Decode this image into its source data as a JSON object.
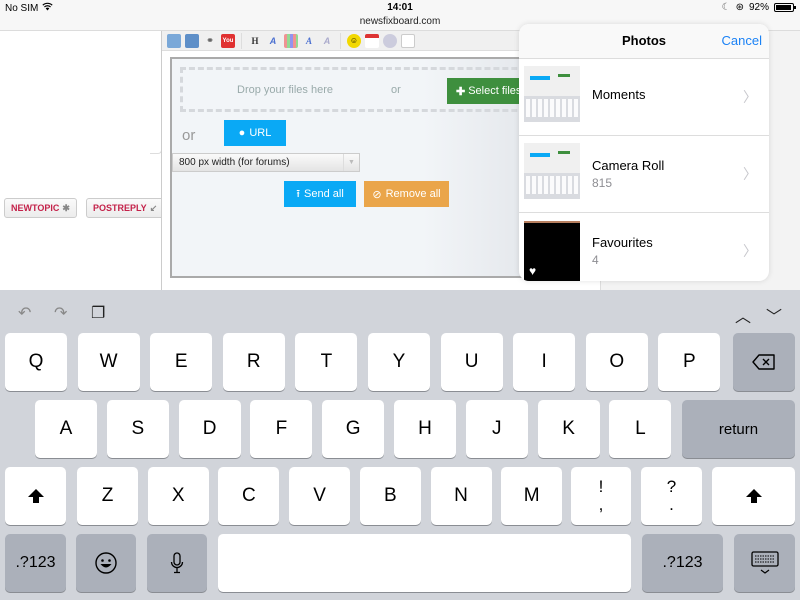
{
  "status_bar": {
    "carrier": "No SIM",
    "time": "14:01",
    "url": "newsfixboard.com",
    "battery_percent": "92%",
    "battery_level": 0.92
  },
  "forum": {
    "new_topic": "NEWTOPIC",
    "post_reply": "POSTREPLY",
    "toolbar_icons": [
      "upload-image-icon",
      "upload-screen-icon",
      "link-icon",
      "youtube-icon",
      "heading-icon",
      "italic-a-icon",
      "color-grid-icon",
      "font-a-icon",
      "font-clear-icon",
      "smiley-icon",
      "calendar-icon",
      "clock-icon",
      "document-icon"
    ]
  },
  "uploader": {
    "drop_text": "Drop your files here",
    "drop_or": "or",
    "select_files": "Select files",
    "url_or": "or",
    "url_button": "URL",
    "size_select": "800 px width (for forums)",
    "send_all": "Send all",
    "remove_all": "Remove all"
  },
  "photos_popover": {
    "title": "Photos",
    "cancel": "Cancel",
    "albums": [
      {
        "name": "Moments",
        "count": null
      },
      {
        "name": "Camera Roll",
        "count": "815"
      },
      {
        "name": "Favourites",
        "count": "4"
      }
    ]
  },
  "keyboard": {
    "row1": [
      "Q",
      "W",
      "E",
      "R",
      "T",
      "Y",
      "U",
      "I",
      "O",
      "P"
    ],
    "row2": [
      "A",
      "S",
      "D",
      "F",
      "G",
      "H",
      "J",
      "K",
      "L"
    ],
    "row3": [
      "Z",
      "X",
      "C",
      "V",
      "B",
      "N",
      "M"
    ],
    "punct1": [
      "!",
      ","
    ],
    "punct2": [
      "?",
      "."
    ],
    "return": "return",
    "numbers": ".?123"
  }
}
